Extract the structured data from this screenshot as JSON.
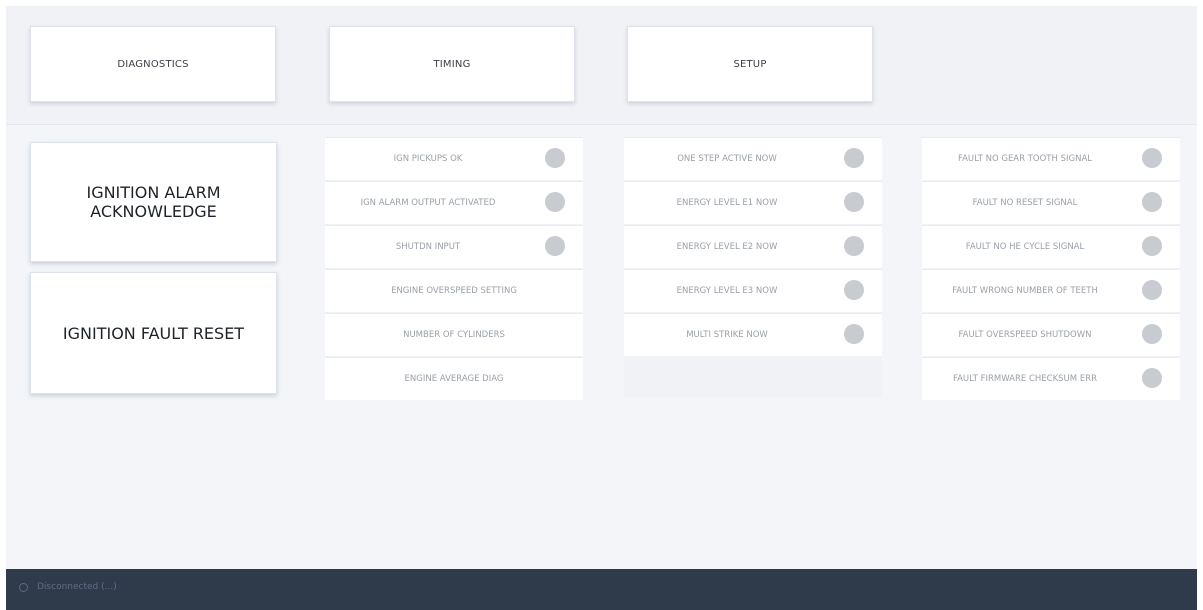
{
  "nav": {
    "diagnostics": "DIAGNOSTICS",
    "timing": "TIMING",
    "setup": "SETUP"
  },
  "actions": {
    "alarm_ack": "IGNITION ALARM ACKNOWLEDGE",
    "fault_reset": "IGNITION FAULT RESET"
  },
  "columns": [
    {
      "rows": [
        {
          "label": "IGN PICKUPS OK",
          "led": "off"
        },
        {
          "label": "IGN ALARM OUTPUT ACTIVATED",
          "led": "off"
        },
        {
          "label": "SHUTDN INPUT",
          "led": "off"
        },
        {
          "label": "ENGINE OVERSPEED SETTING",
          "led": "none"
        },
        {
          "label": "NUMBER OF CYLINDERS",
          "led": "none"
        },
        {
          "label": "ENGINE AVERAGE DIAG",
          "led": "none"
        }
      ]
    },
    {
      "rows": [
        {
          "label": "ONE STEP ACTIVE NOW",
          "led": "off"
        },
        {
          "label": "ENERGY LEVEL E1 NOW",
          "led": "off"
        },
        {
          "label": "ENERGY LEVEL E2 NOW",
          "led": "off"
        },
        {
          "label": "ENERGY LEVEL E3 NOW",
          "led": "off"
        },
        {
          "label": "MULTI STRIKE NOW",
          "led": "off"
        }
      ]
    },
    {
      "rows": [
        {
          "label": "FAULT NO GEAR TOOTH SIGNAL",
          "led": "off"
        },
        {
          "label": "FAULT NO RESET SIGNAL",
          "led": "off"
        },
        {
          "label": "FAULT NO HE CYCLE SIGNAL",
          "led": "off"
        },
        {
          "label": "FAULT WRONG NUMBER OF TEETH",
          "led": "off"
        },
        {
          "label": "FAULT OVERSPEED SHUTDOWN",
          "led": "off"
        },
        {
          "label": "FAULT FIRMWARE CHECKSUM ERR",
          "led": "off"
        }
      ]
    }
  ],
  "status": {
    "connection": "Disconnected (...)",
    "icon": "connection-status-icon"
  },
  "colors": {
    "led_off": "#c8cbcf",
    "status_bar": "#2f3a4a"
  }
}
